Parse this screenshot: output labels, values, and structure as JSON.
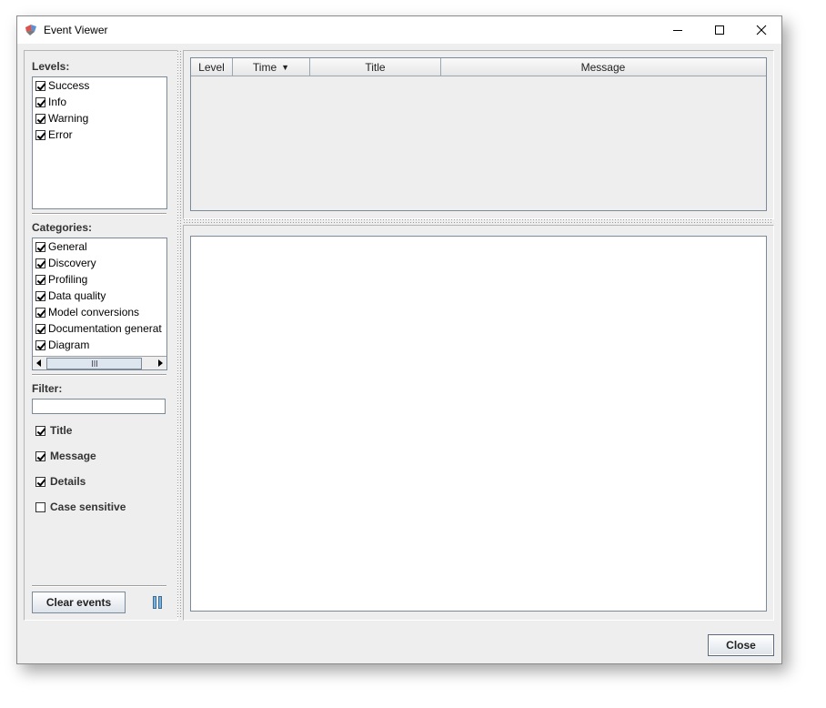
{
  "window": {
    "title": "Event Viewer"
  },
  "levels": {
    "label": "Levels:",
    "items": [
      {
        "label": "Success",
        "checked": true
      },
      {
        "label": "Info",
        "checked": true
      },
      {
        "label": "Warning",
        "checked": true
      },
      {
        "label": "Error",
        "checked": true
      }
    ]
  },
  "categories": {
    "label": "Categories:",
    "items": [
      {
        "label": "General",
        "checked": true
      },
      {
        "label": "Discovery",
        "checked": true
      },
      {
        "label": "Profiling",
        "checked": true
      },
      {
        "label": "Data quality",
        "checked": true
      },
      {
        "label": "Model conversions",
        "checked": true
      },
      {
        "label": "Documentation generat",
        "checked": true
      },
      {
        "label": "Diagram",
        "checked": true
      }
    ]
  },
  "filter": {
    "label": "Filter:",
    "value": "",
    "options": [
      {
        "label": "Title",
        "checked": true
      },
      {
        "label": "Message",
        "checked": true
      },
      {
        "label": "Details",
        "checked": true
      },
      {
        "label": "Case sensitive",
        "checked": false
      }
    ]
  },
  "buttons": {
    "clear_events": "Clear events",
    "close": "Close"
  },
  "table": {
    "columns": [
      "Level",
      "Time",
      "Title",
      "Message"
    ],
    "sort_indicator": "▼"
  },
  "icons": {
    "app": "event-viewer-app-icon",
    "minimize": "minimize-icon",
    "maximize": "maximize-icon",
    "close": "close-icon",
    "pause": "pause-icon"
  }
}
